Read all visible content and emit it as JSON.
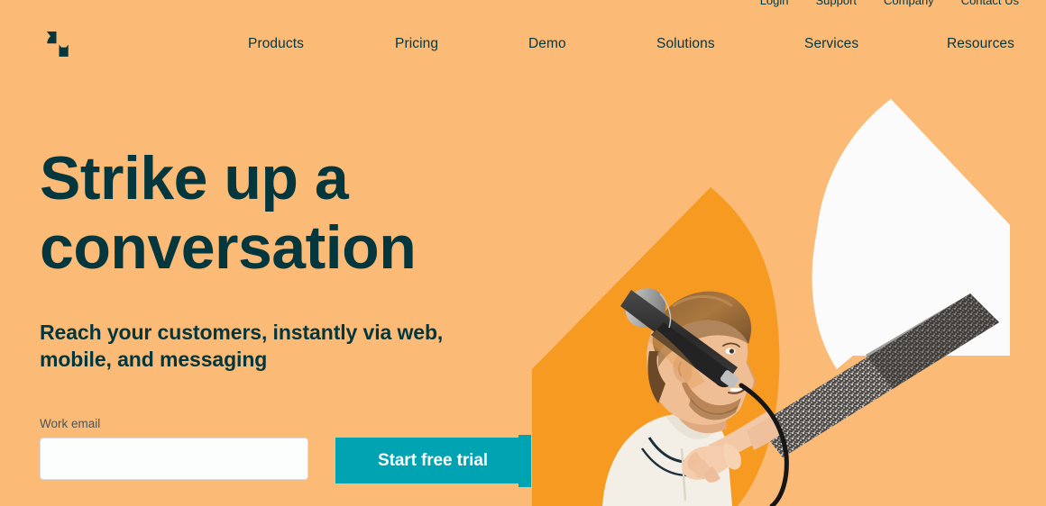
{
  "brand": {
    "name": "Zendesk",
    "logo_icon": "zendesk-z-logo",
    "colors": {
      "background_peach": "#FBBB76",
      "shape_orange": "#F79A22",
      "shape_white": "#FBFBFB",
      "text_dark_teal": "#03363D",
      "accent_teal": "#00A3B1",
      "label_gray": "#49545C"
    }
  },
  "utility_bar": {
    "links": [
      {
        "label": "Login"
      },
      {
        "label": "Support"
      },
      {
        "label": "Company"
      },
      {
        "label": "Contact Us"
      }
    ]
  },
  "nav": {
    "items": [
      {
        "label": "Products"
      },
      {
        "label": "Pricing"
      },
      {
        "label": "Demo"
      },
      {
        "label": "Solutions"
      },
      {
        "label": "Services"
      },
      {
        "label": "Resources"
      }
    ]
  },
  "hero": {
    "title": "Strike up a conversation",
    "subtitle": "Reach your customers, instantly via web, mobile, and messaging",
    "image_alt": "Man in profile speaking into a microphone held by an arm emerging from a white petal shape, over an orange petal shape"
  },
  "form": {
    "email_label": "Work email",
    "email_value": "",
    "email_placeholder": "",
    "submit_label": "Start free trial"
  }
}
